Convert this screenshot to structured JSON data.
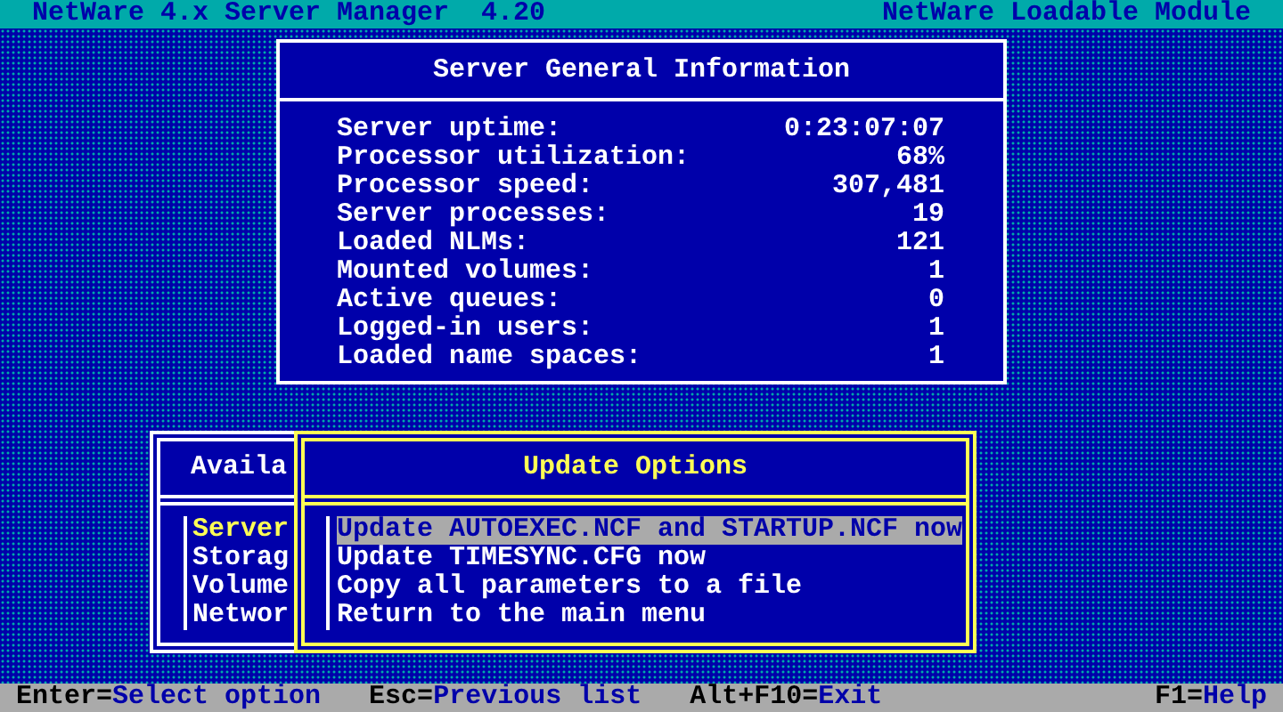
{
  "header": {
    "title": "NetWare 4.x Server Manager  4.20",
    "subtitle": "NetWare Loadable Module"
  },
  "info_window": {
    "title": "Server General Information",
    "rows": [
      {
        "label": "Server uptime:",
        "value": "0:23:07:07"
      },
      {
        "label": "Processor utilization:",
        "value": "68%"
      },
      {
        "label": "Processor speed:",
        "value": "307,481"
      },
      {
        "label": "Server processes:",
        "value": "19"
      },
      {
        "label": "Loaded NLMs:",
        "value": "121"
      },
      {
        "label": "Mounted volumes:",
        "value": "1"
      },
      {
        "label": "Active queues:",
        "value": "0"
      },
      {
        "label": "Logged-in users:",
        "value": "1"
      },
      {
        "label": "Loaded name spaces:",
        "value": "1"
      }
    ]
  },
  "available_menu": {
    "title": "Availa",
    "items": [
      {
        "label": "Server",
        "selected": true
      },
      {
        "label": "Storag",
        "selected": false
      },
      {
        "label": "Volume",
        "selected": false
      },
      {
        "label": "Networ",
        "selected": false
      }
    ]
  },
  "update_menu": {
    "title": "Update Options",
    "items": [
      {
        "label": "Update AUTOEXEC.NCF and STARTUP.NCF now",
        "selected": true
      },
      {
        "label": "Update TIMESYNC.CFG now",
        "selected": false
      },
      {
        "label": "Copy all parameters to a file",
        "selected": false
      },
      {
        "label": "Return to the main menu",
        "selected": false
      }
    ]
  },
  "status_bar": [
    {
      "key": "Enter=",
      "action": "Select option"
    },
    {
      "key": "Esc=",
      "action": "Previous list"
    },
    {
      "key": "Alt+F10=",
      "action": "Exit"
    },
    {
      "key": "F1=",
      "action": "Help"
    }
  ]
}
